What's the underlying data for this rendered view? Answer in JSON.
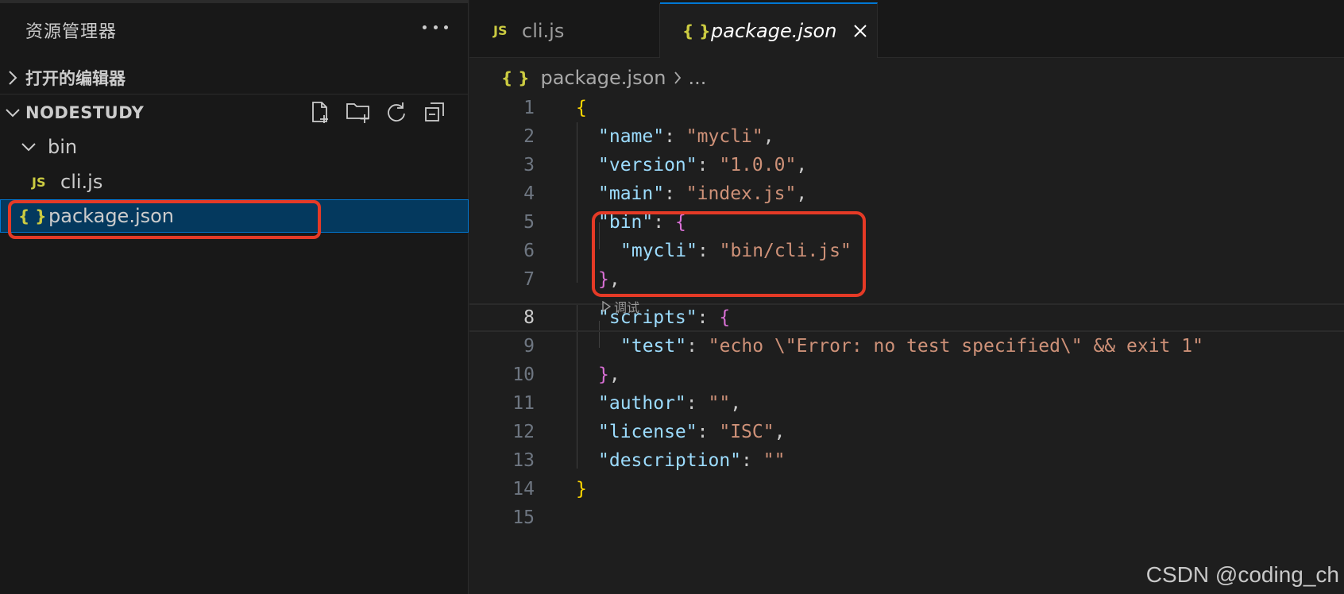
{
  "sidebar": {
    "title": "资源管理器",
    "more_icon": "ellipsis-icon",
    "open_editors_label": "打开的编辑器",
    "project_label": "NODESTUDY",
    "actions": [
      "new-file-icon",
      "new-folder-icon",
      "refresh-icon",
      "collapse-all-icon"
    ],
    "tree": {
      "folder": "bin",
      "file_cli": {
        "icon": "JS",
        "name": "cli.js"
      },
      "file_pkg": {
        "icon": "{ }",
        "name": "package.json"
      }
    }
  },
  "tabs": [
    {
      "icon": "JS",
      "name": "cli.js",
      "active": false
    },
    {
      "icon": "{ }",
      "name": "package.json",
      "active": true
    }
  ],
  "breadcrumb": {
    "icon": "{ }",
    "file": "package.json",
    "rest": "..."
  },
  "codelens": "调试",
  "code_lines": [
    {
      "n": "1"
    },
    {
      "n": "2"
    },
    {
      "n": "3"
    },
    {
      "n": "4"
    },
    {
      "n": "5"
    },
    {
      "n": "6"
    },
    {
      "n": "7"
    },
    {
      "n": "8"
    },
    {
      "n": "9"
    },
    {
      "n": "10"
    },
    {
      "n": "11"
    },
    {
      "n": "12"
    },
    {
      "n": "13"
    },
    {
      "n": "14"
    },
    {
      "n": "15"
    }
  ],
  "json": {
    "name": "mycli",
    "version": "1.0.0",
    "main": "index.js",
    "bin_mycli": "bin/cli.js",
    "test": "echo \\\"Error: no test specified\\\" && exit 1",
    "author": "",
    "license": "ISC",
    "description": ""
  },
  "watermark": "CSDN @coding_ch",
  "colors": {
    "accent": "#0078d4",
    "highlight": "#e53a26",
    "selection": "#04395e"
  }
}
